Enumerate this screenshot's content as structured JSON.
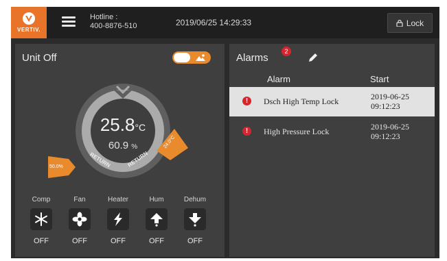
{
  "brand": {
    "name": "VERTIV."
  },
  "header": {
    "hotline_label": "Hotline :",
    "hotline_number": "400-8876-510",
    "datetime": "2019/06/25 14:29:33",
    "lock_label": "Lock"
  },
  "unit": {
    "title": "Unit Off",
    "temperature": "25.8",
    "temperature_unit": "°C",
    "humidity": "60.9",
    "humidity_unit": "%",
    "return_label_left": "RETURN",
    "return_label_right": "RETURN",
    "left_flag": "50.0%",
    "right_flag": "24.0°C",
    "components": [
      {
        "label": "Comp",
        "state": "OFF",
        "icon": "snowflake-icon"
      },
      {
        "label": "Fan",
        "state": "OFF",
        "icon": "fan-icon"
      },
      {
        "label": "Heater",
        "state": "OFF",
        "icon": "lightning-icon"
      },
      {
        "label": "Hum",
        "state": "OFF",
        "icon": "arrow-up-icon"
      },
      {
        "label": "Dehum",
        "state": "OFF",
        "icon": "arrow-down-icon"
      }
    ]
  },
  "alarms": {
    "title": "Alarms",
    "count": "2",
    "col_alarm": "Alarm",
    "col_start": "Start",
    "rows": [
      {
        "name": "Dsch High Temp Lock",
        "date": "2019-06-25",
        "time": "09:12:23"
      },
      {
        "name": "High Pressure Lock",
        "date": "2019-06-25",
        "time": "09:12:23"
      }
    ]
  },
  "colors": {
    "accent": "#e98a2d",
    "alarm": "#d4262f",
    "selected_row": "#e2e2e2"
  }
}
